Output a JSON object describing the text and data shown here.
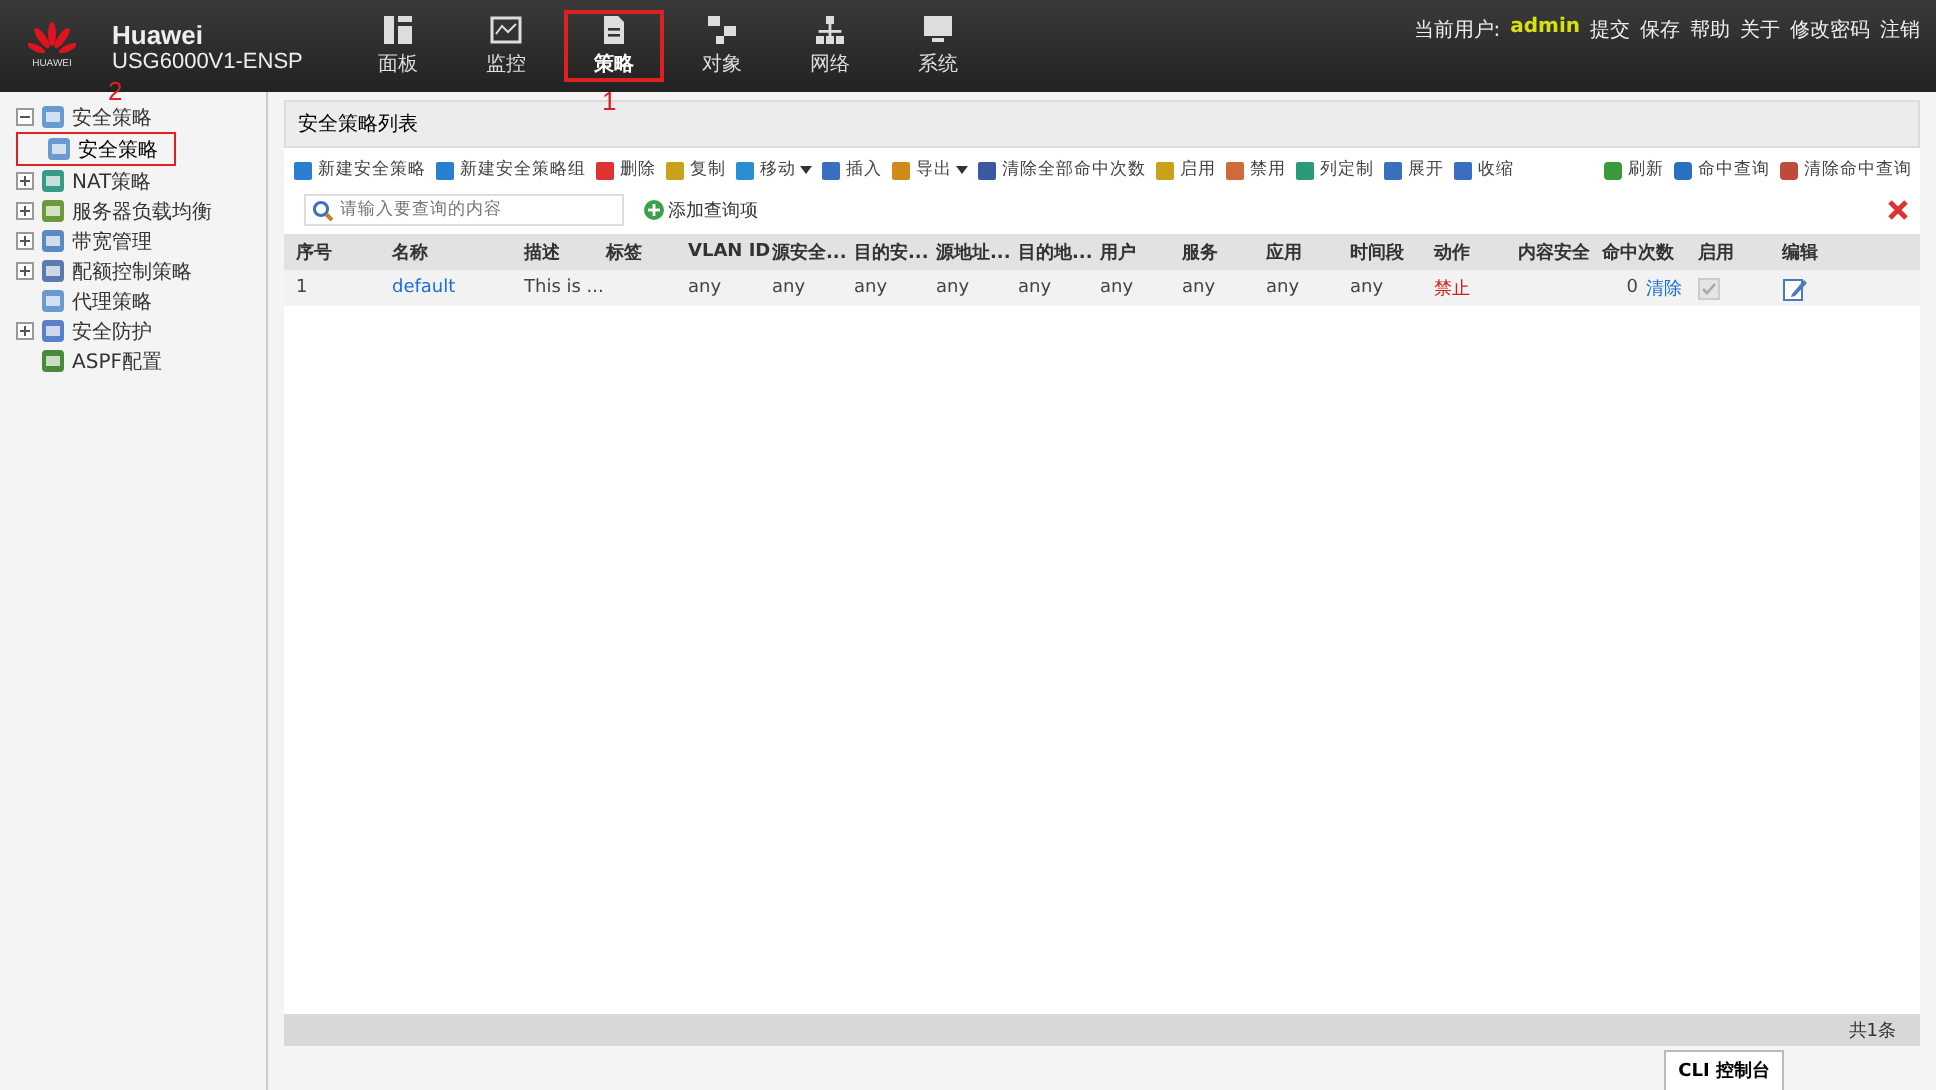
{
  "header": {
    "logo_text": "HUAWEI",
    "brand": "Huawei",
    "model": "USG6000V1-ENSP",
    "nav": [
      {
        "label": "面板",
        "selected": false,
        "boxed": false
      },
      {
        "label": "监控",
        "selected": false,
        "boxed": false
      },
      {
        "label": "策略",
        "selected": true,
        "boxed": true
      },
      {
        "label": "对象",
        "selected": false,
        "boxed": false
      },
      {
        "label": "网络",
        "selected": false,
        "boxed": false
      },
      {
        "label": "系统",
        "selected": false,
        "boxed": false
      }
    ],
    "user_label": "当前用户:",
    "user": "admin",
    "links": [
      "提交",
      "保存",
      "帮助",
      "关于",
      "修改密码",
      "注销"
    ]
  },
  "annotations": [
    {
      "label": "2"
    },
    {
      "label": "1"
    }
  ],
  "sidebar": {
    "items": [
      {
        "label": "安全策略",
        "expanded": true,
        "selected": false,
        "boxed": false,
        "children": [
          {
            "label": "安全策略",
            "selected": true,
            "boxed": true
          }
        ]
      },
      {
        "label": "NAT策略",
        "expanded": false,
        "selected": false,
        "boxed": false
      },
      {
        "label": "服务器负载均衡",
        "expanded": false,
        "selected": false,
        "boxed": false
      },
      {
        "label": "带宽管理",
        "expanded": false,
        "selected": false,
        "boxed": false
      },
      {
        "label": "配额控制策略",
        "expanded": false,
        "selected": false,
        "boxed": false
      },
      {
        "label": "代理策略",
        "selected": false,
        "boxed": false
      },
      {
        "label": "安全防护",
        "expanded": false,
        "selected": false,
        "boxed": false
      },
      {
        "label": "ASPF配置",
        "selected": false,
        "boxed": false
      }
    ]
  },
  "panel": {
    "title": "安全策略列表",
    "toolbar": [
      {
        "label": "新建安全策略",
        "dropdown": false
      },
      {
        "label": "新建安全策略组",
        "dropdown": false
      },
      {
        "label": "删除",
        "dropdown": false
      },
      {
        "label": "复制",
        "dropdown": false
      },
      {
        "label": "移动",
        "dropdown": true
      },
      {
        "label": "插入",
        "dropdown": false
      },
      {
        "label": "导出",
        "dropdown": true
      },
      {
        "label": "清除全部命中次数",
        "dropdown": false
      },
      {
        "label": "启用",
        "dropdown": false
      },
      {
        "label": "禁用",
        "dropdown": false
      },
      {
        "label": "列定制",
        "dropdown": false
      },
      {
        "label": "展开",
        "dropdown": false
      },
      {
        "label": "收缩",
        "dropdown": false
      }
    ],
    "toolbar_right": [
      "刷新",
      "命中查询",
      "清除命中查询"
    ],
    "search": {
      "placeholder": "请输入要查询的内容"
    },
    "add_query": "添加查询项",
    "table": {
      "columns": [
        "序号",
        "名称",
        "描述",
        "标签",
        "VLAN ID",
        "源安全...",
        "目的安...",
        "源地址...",
        "目的地...",
        "用户",
        "服务",
        "应用",
        "时间段",
        "动作",
        "内容安全",
        "命中次数",
        "启用",
        "编辑"
      ],
      "rows": [
        {
          "index": "1",
          "name": "default",
          "description": "This is ...",
          "vlan": "any",
          "src_zone": "any",
          "dst_zone": "any",
          "src_addr": "any",
          "dst_addr": "any",
          "user": "any",
          "service": "any",
          "application": "any",
          "schedule": "any",
          "action": "禁止",
          "hits": "0",
          "clear": "清除",
          "enabled": true
        }
      ]
    },
    "total": "共1条"
  },
  "cli_tab": "CLI 控制台"
}
